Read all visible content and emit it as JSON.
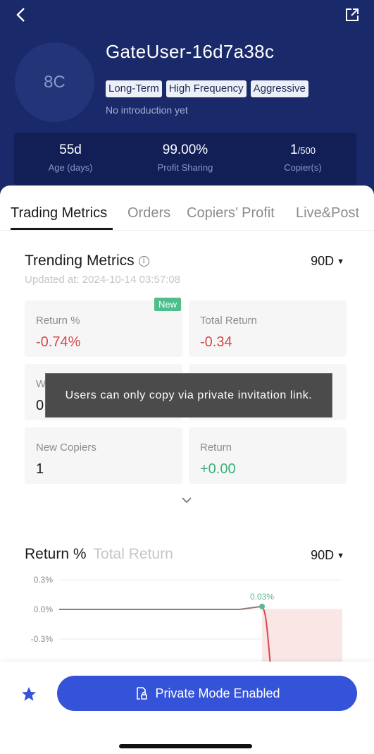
{
  "profile": {
    "avatar_initials": "8C",
    "username": "GateUser-16d7a38c",
    "tags": [
      "Long-Term",
      "High Frequency",
      "Aggressive"
    ],
    "intro": "No introduction yet"
  },
  "stats": [
    {
      "value": "55d",
      "label": "Age (days)"
    },
    {
      "value": "99.00%",
      "label": "Profit Sharing"
    },
    {
      "value": "1",
      "value_suffix": "/500",
      "label": "Copier(s)"
    }
  ],
  "tabs": [
    "Trading Metrics",
    "Orders",
    "Copiers’ Profit",
    "Live&Post"
  ],
  "metrics": {
    "title": "Trending Metrics",
    "updated": "Updated at: 2024-10-14 03:57:08",
    "period": "90D",
    "new_badge": "New",
    "cards": [
      {
        "label": "Return %",
        "value": "-0.74%"
      },
      {
        "label": "Total Return",
        "value": "-0.34"
      },
      {
        "label": "W",
        "value": "0"
      },
      {
        "label": "",
        "value": ""
      },
      {
        "label": "New Copiers",
        "value": "1"
      },
      {
        "label": "Return",
        "value": "+0.00"
      }
    ]
  },
  "toast": "Users can only copy via private invitation link.",
  "chart_section": {
    "tab_active": "Return %",
    "tab_inactive": "Total Return",
    "period": "90D"
  },
  "chart_data": {
    "type": "line",
    "title": "",
    "xlabel": "",
    "ylabel": "",
    "y_ticks": [
      "0.3%",
      "0.0%",
      "-0.3%"
    ],
    "ylim": [
      -0.3,
      0.3
    ],
    "series": [
      {
        "values": [
          0.0,
          0.0,
          0.0,
          0.0,
          0.0,
          0.0,
          0.0,
          0.0,
          0.0,
          0.03,
          -0.74
        ]
      }
    ],
    "annotation": "0.03%",
    "colors": {
      "line": "#8b7a72",
      "drop": "#d3494e",
      "point": "#5cb88a",
      "fill": "#fbe6e6"
    }
  },
  "bottom": {
    "cta_label": "Private Mode Enabled"
  },
  "colors": {
    "header_bg": "#19296a",
    "accent": "#3453d8",
    "negative": "#d3494e",
    "positive": "#3bb27a"
  }
}
